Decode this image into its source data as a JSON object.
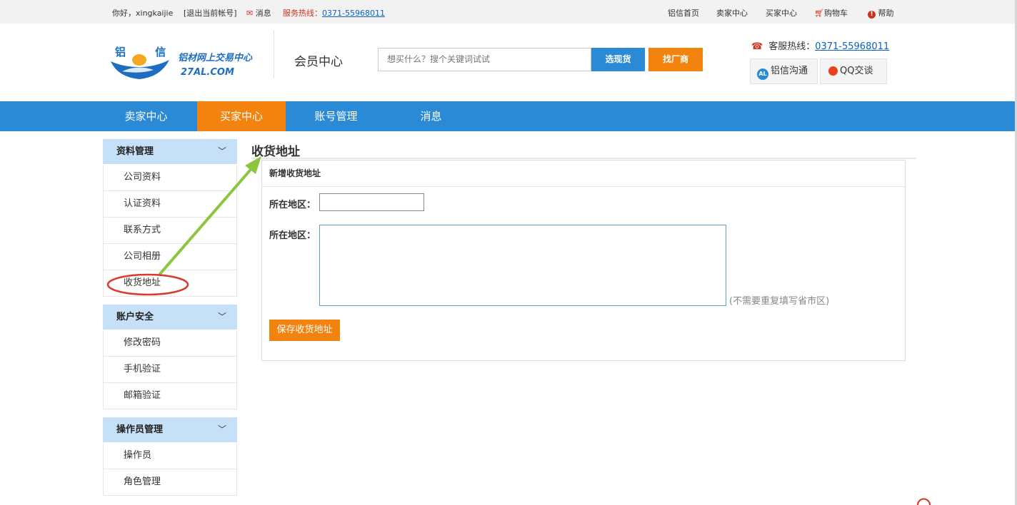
{
  "topbar": {
    "greeting": "你好，xingkaijie",
    "logout": "[退出当前帐号]",
    "message": "消息",
    "hotline_label": "服务热线：",
    "hotline_number": "0371-55968011",
    "links": [
      "铝信首页",
      "卖家中心",
      "买家中心",
      "购物车",
      "帮助"
    ]
  },
  "header": {
    "logo_cn": "铝 信",
    "logo_slogan": "铝材网上交易中心",
    "logo_domain": "27AL.COM",
    "title": "会员中心",
    "search_placeholder": "想买什么？搜个关键词试试",
    "search_button": "选现货",
    "find_factory_button": "找厂商",
    "service_label": "客服热线：",
    "service_number": "0371-55968011",
    "chat_button": "铝信沟通",
    "chat_icon_text": "AL",
    "qq_button": "QQ交谈"
  },
  "nav": {
    "items": [
      "卖家中心",
      "买家中心",
      "账号管理",
      "消息"
    ],
    "active": "买家中心"
  },
  "sidebar": {
    "groups": [
      {
        "title": "资料管理",
        "items": [
          "公司资料",
          "认证资料",
          "联系方式",
          "公司相册",
          "收货地址"
        ]
      },
      {
        "title": "账户安全",
        "items": [
          "修改密码",
          "手机验证",
          "邮箱验证"
        ]
      },
      {
        "title": "操作员管理",
        "items": [
          "操作员",
          "角色管理"
        ]
      }
    ]
  },
  "main": {
    "page_title": "收货地址",
    "panel_title": "新增收货地址",
    "region_label": "所在地区：",
    "address_label": "所在地区：",
    "address_hint": "(不需要重复填写省市区)",
    "save_button": "保存收货地址"
  },
  "colors": {
    "primary_blue": "#2b8ad6",
    "accent_orange": "#f3830f",
    "sidebar_header": "#c6e0f8",
    "annotation_green": "#8cc63f",
    "annotation_red": "#d93a2b"
  }
}
